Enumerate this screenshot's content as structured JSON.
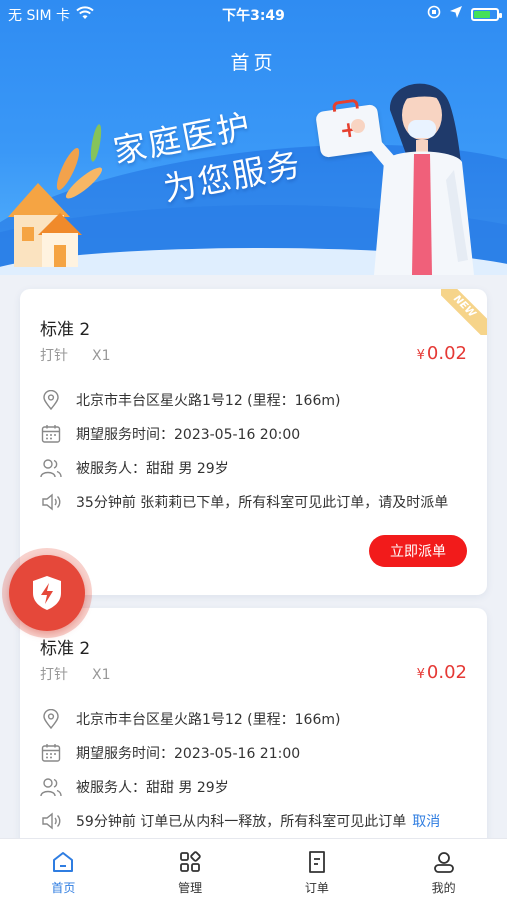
{
  "status_bar": {
    "carrier": "无 SIM 卡",
    "time": "下午3:49"
  },
  "header": {
    "title": "首页",
    "slogan_line1": "家庭医护",
    "slogan_line2": "为您服务"
  },
  "orders": [
    {
      "title": "标准 2",
      "service": "打针",
      "quantity": "X1",
      "currency": "¥",
      "price": "0.02",
      "badge": "NEW",
      "address": "北京市丰台区星火路1号12 (里程：166m)",
      "expected_time": "期望服务时间：2023-05-16 20:00",
      "patient": "被服务人：甜甜  男  29岁",
      "notice": "35分钟前 张莉莉已下单，所有科室可见此订单，请及时派单",
      "action_label": "立即派单"
    },
    {
      "title": "标准 2",
      "service": "打针",
      "quantity": "X1",
      "currency": "¥",
      "price": "0.02",
      "address": "北京市丰台区星火路1号12 (里程：166m)",
      "expected_time": "期望服务时间：2023-05-16 21:00",
      "patient": "被服务人：甜甜  男  29岁",
      "notice": "59分钟前 订单已从内科一释放，所有科室可见此订单",
      "cancel_label": "取消"
    }
  ],
  "tabs": [
    {
      "label": "首页",
      "icon": "home-icon",
      "active": true
    },
    {
      "label": "管理",
      "icon": "grid-icon",
      "active": false
    },
    {
      "label": "订单",
      "icon": "order-icon",
      "active": false
    },
    {
      "label": "我的",
      "icon": "user-icon",
      "active": false
    }
  ],
  "colors": {
    "primary": "#2f7de1",
    "accent_red": "#f21b1b",
    "price_red": "#e53935",
    "banner_blue": "#2f8cf2"
  }
}
